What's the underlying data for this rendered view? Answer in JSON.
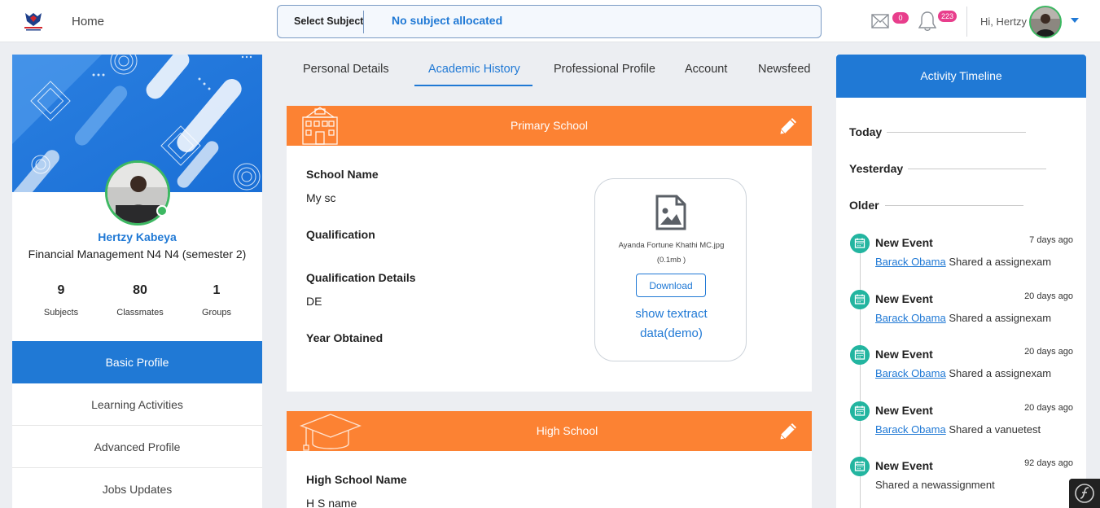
{
  "topbar": {
    "home_label": "Home",
    "subject_label": "Select Subject",
    "subject_value": "No subject allocated",
    "mail_count": "0",
    "notification_count": "223",
    "greeting": "Hi, Hertzy"
  },
  "profile": {
    "name": "Hertzy Kabeya",
    "course": "Financial Management N4 N4 (semester 2)",
    "stats": [
      {
        "value": "9",
        "label": "Subjects"
      },
      {
        "value": "80",
        "label": "Classmates"
      },
      {
        "value": "1",
        "label": "Groups"
      }
    ],
    "menu": [
      "Basic Profile",
      "Learning Activities",
      "Advanced Profile",
      "Jobs Updates"
    ],
    "active_menu": "Basic Profile"
  },
  "tabs": [
    "Personal Details",
    "Academic History",
    "Professional Profile",
    "Account",
    "Newsfeed"
  ],
  "active_tab": "Academic History",
  "primary_school": {
    "title": "Primary School",
    "school_name_label": "School Name",
    "school_name": "My sc",
    "qualification_label": "Qualification",
    "qualification": "",
    "qualification_details_label": "Qualification Details",
    "qualification_details": "DE",
    "year_obtained_label": "Year Obtained",
    "year_obtained": "",
    "file": {
      "name": "Ayanda Fortune Khathi MC.jpg",
      "size": "(0.1mb )",
      "download_label": "Download",
      "textract_label": "show textract data(demo)"
    }
  },
  "high_school": {
    "title": "High School",
    "school_name_label": "High School Name",
    "school_name": "H S name"
  },
  "timeline": {
    "title": "Activity Timeline",
    "sections": [
      "Today",
      "Yesterday",
      "Older"
    ],
    "events": [
      {
        "title": "New Event",
        "time": "7 days ago",
        "actor": "Barack Obama",
        "text": " Shared a assignexam"
      },
      {
        "title": "New Event",
        "time": "20 days ago",
        "actor": "Barack Obama",
        "text": " Shared a assignexam"
      },
      {
        "title": "New Event",
        "time": "20 days ago",
        "actor": "Barack Obama",
        "text": " Shared a assignexam"
      },
      {
        "title": "New Event",
        "time": "20 days ago",
        "actor": "Barack Obama",
        "text": " Shared a vanuetest"
      },
      {
        "title": "New Event",
        "time": "92 days ago",
        "actor": "",
        "text": "Shared a newassignment"
      }
    ]
  },
  "colors": {
    "accent": "#2079d5",
    "card_header": "#fc8233",
    "online": "#3db862",
    "badge": "#e83e8c",
    "event_icon": "#23b5a0"
  }
}
